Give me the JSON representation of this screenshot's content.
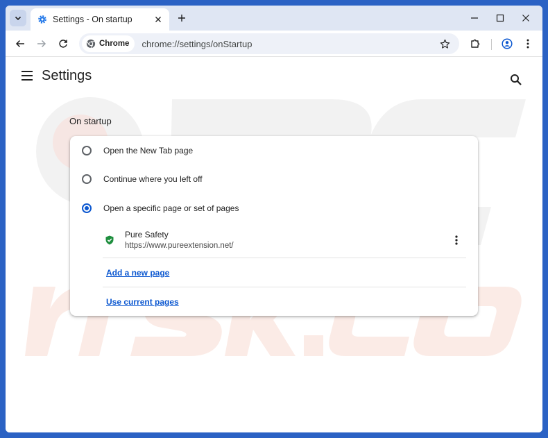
{
  "colors": {
    "frame": "#2b62c4",
    "tabstrip": "#dfe6f3",
    "accent": "#0b57d0",
    "shield": "#1e8e3e",
    "watermark": "#f0f0f0"
  },
  "tab": {
    "title": "Settings - On startup",
    "favicon": "gear-icon"
  },
  "toolbar": {
    "chip_label": "Chrome",
    "url": "chrome://settings/onStartup"
  },
  "header": {
    "title": "Settings"
  },
  "section": {
    "title": "On startup"
  },
  "startup": {
    "options": [
      {
        "label": "Open the New Tab page",
        "checked": false
      },
      {
        "label": "Continue where you left off",
        "checked": false
      },
      {
        "label": "Open a specific page or set of pages",
        "checked": true
      }
    ],
    "pages": [
      {
        "name": "Pure Safety",
        "url": "https://www.pureextension.net/"
      }
    ],
    "add_page_label": "Add a new page",
    "use_current_label": "Use current pages"
  }
}
